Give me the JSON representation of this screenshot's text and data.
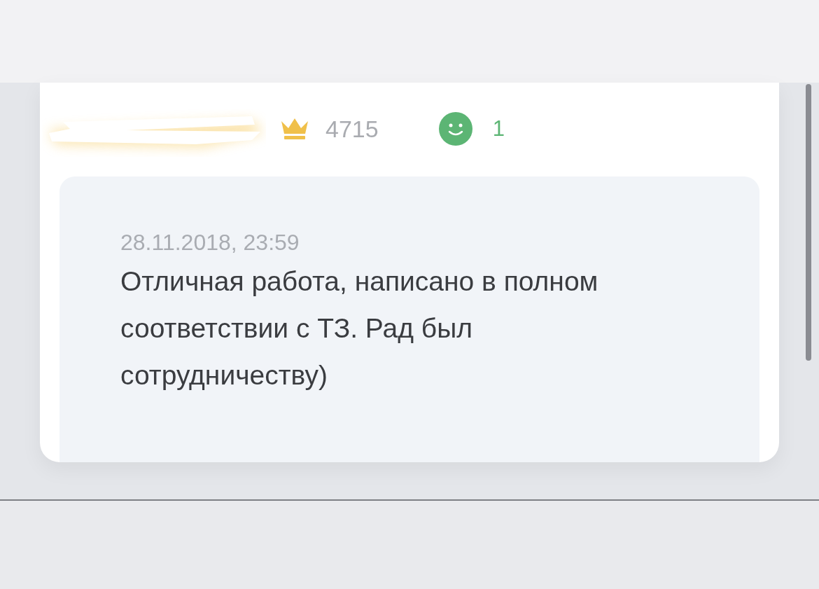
{
  "review": {
    "rating": "4715",
    "positive_count": "1",
    "date": "28.11.2018, 23:59",
    "text": "Отличная работа, написано в полном соответствии с ТЗ. Рад был сотрудничеству)"
  }
}
